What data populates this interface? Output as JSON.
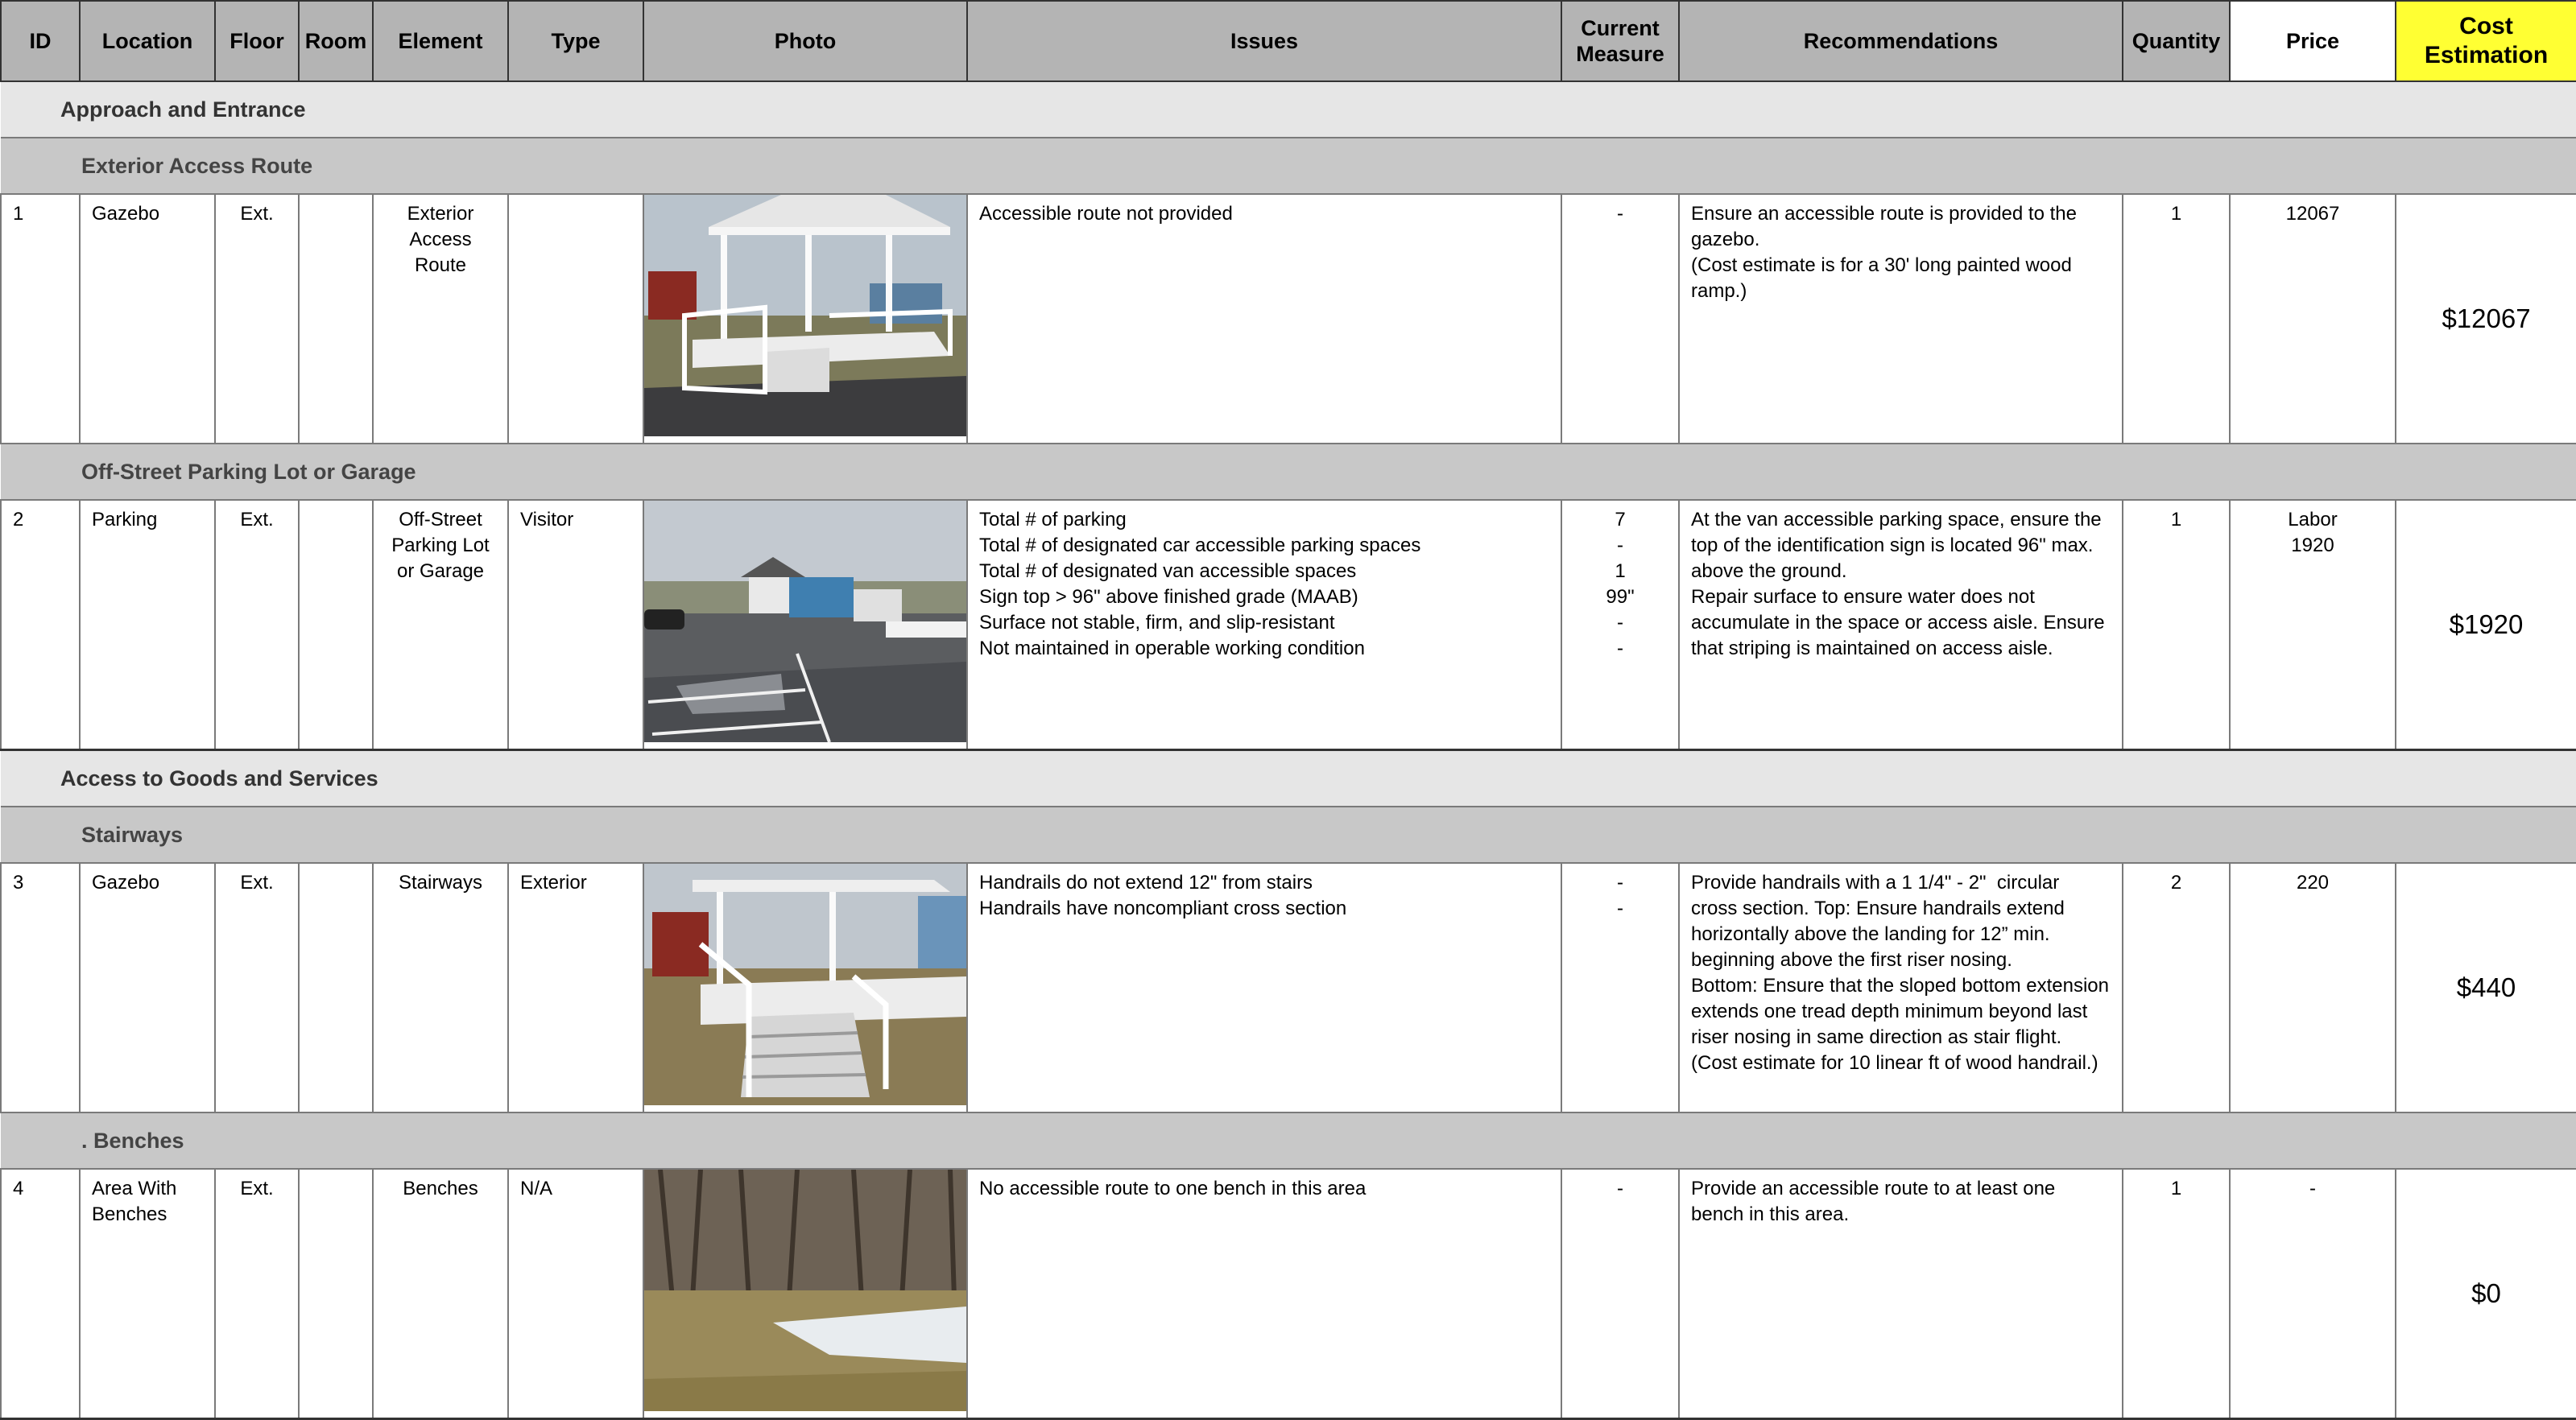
{
  "headers": {
    "id": "ID",
    "location": "Location",
    "floor": "Floor",
    "room": "Room",
    "element": "Element",
    "type": "Type",
    "photo": "Photo",
    "issues": "Issues",
    "current_measure_line1": "Current",
    "current_measure_line2": "Measure",
    "recommendations": "Recommendations",
    "quantity": "Quantity",
    "price": "Price",
    "cost_line1": "Cost",
    "cost_line2": "Estimation"
  },
  "sections": {
    "approach": "Approach and Entrance",
    "exterior_route": "Exterior Access Route",
    "parking": "Off-Street Parking Lot or Garage",
    "goods": "Access to Goods and Services",
    "stairways": "Stairways",
    "benches": ". Benches"
  },
  "rows": [
    {
      "id": "1",
      "location": "Gazebo",
      "floor": "Ext.",
      "room": "",
      "element": [
        "Exterior",
        "Access",
        "Route"
      ],
      "type": "",
      "photo_icon": "gazebo-ramp-photo",
      "issues": [
        "Accessible route not provided"
      ],
      "measure": [
        "-"
      ],
      "recommendations": [
        "Ensure an accessible route is provided to the",
        "gazebo.",
        "(Cost estimate is for a 30' long painted wood",
        "ramp.)"
      ],
      "quantity": "1",
      "price": [
        "12067"
      ],
      "cost": "$12067"
    },
    {
      "id": "2",
      "location": "Parking",
      "floor": "Ext.",
      "room": "",
      "element": [
        "Off-Street",
        "Parking Lot",
        "or Garage"
      ],
      "type": "Visitor",
      "photo_icon": "parking-lot-photo",
      "issues": [
        "Total # of parking",
        "Total # of designated car accessible parking spaces",
        "Total # of designated van accessible spaces",
        "Sign top > 96\" above finished grade (MAAB)",
        "Surface not stable, firm, and slip-resistant",
        "Not maintained in operable working condition"
      ],
      "measure": [
        "7",
        "-",
        "1",
        "99\"",
        "-",
        "-"
      ],
      "recommendations": [
        "At the van accessible parking space, ensure the",
        "top of the identification sign is located 96\" max.",
        "above the ground.",
        "Repair surface to ensure water does not",
        "accumulate in the space or access aisle. Ensure",
        "that striping is maintained on access aisle."
      ],
      "quantity": "1",
      "price": [
        "Labor",
        "1920"
      ],
      "cost": "$1920"
    },
    {
      "id": "3",
      "location": "Gazebo",
      "floor": "Ext.",
      "room": "",
      "element": [
        "Stairways"
      ],
      "type": "Exterior",
      "photo_icon": "gazebo-stairs-photo",
      "issues": [
        "Handrails do not extend 12\" from stairs",
        "Handrails have noncompliant cross section"
      ],
      "measure": [
        "-",
        "-"
      ],
      "recommendations": [
        "Provide handrails with a 1 1/4\" - 2\"  circular",
        "cross section. Top: Ensure handrails extend",
        "horizontally above the landing for 12” min.",
        "beginning above the first riser nosing.",
        "Bottom: Ensure that the sloped bottom extension",
        "extends one tread depth minimum beyond last",
        "riser nosing in same direction as stair flight.",
        "(Cost estimate for 10 linear ft of wood handrail.)"
      ],
      "quantity": "2",
      "price": [
        "220"
      ],
      "cost": "$440"
    },
    {
      "id": "4",
      "location": "Area With Benches",
      "floor": "Ext.",
      "room": "",
      "element": [
        "Benches"
      ],
      "type": "N/A",
      "photo_icon": "bench-area-photo",
      "issues": [
        "No accessible route to one bench in this area"
      ],
      "measure": [
        "-"
      ],
      "recommendations": [
        "Provide an accessible route to at least one",
        "bench in this area."
      ],
      "quantity": "1",
      "price": [
        "-"
      ],
      "cost": "$0"
    }
  ],
  "colors": {
    "header_gray": "#b4b4b4",
    "section_gray": "#e6e6e6",
    "subsection_gray": "#c8c8c8",
    "cost_header_yellow": "#ffff33"
  }
}
